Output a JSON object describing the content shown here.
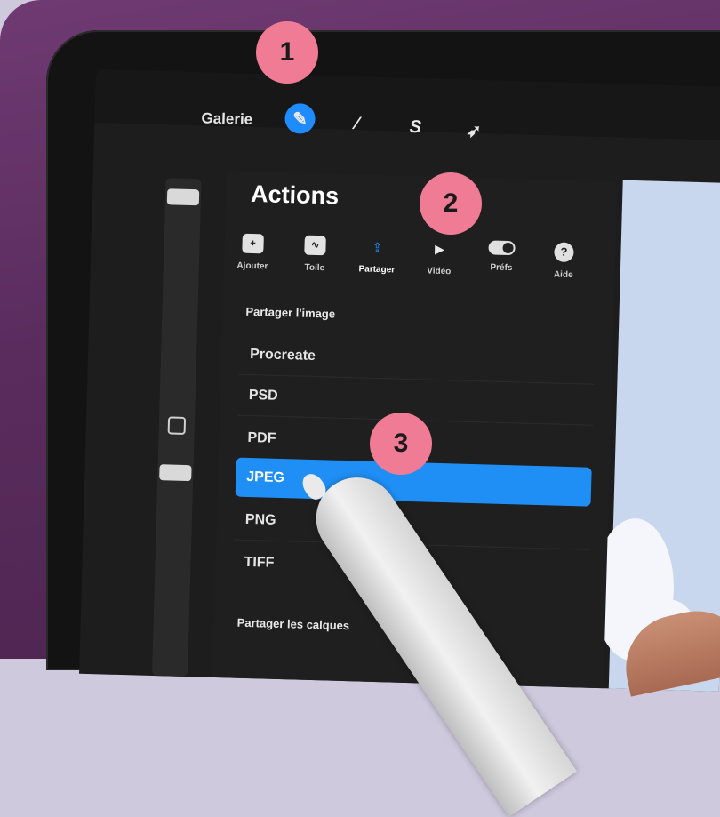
{
  "toolbar": {
    "gallery_label": "Galerie",
    "tools": [
      {
        "icon": "wrench-icon",
        "glyph": "✎",
        "active": true
      },
      {
        "icon": "magic-wand-icon",
        "glyph": "⁄"
      },
      {
        "icon": "selection-icon",
        "glyph": "S"
      },
      {
        "icon": "move-arrow-icon",
        "glyph": "➶"
      }
    ]
  },
  "actions_panel": {
    "title": "Actions",
    "tabs": [
      {
        "label": "Ajouter",
        "icon": "add-icon",
        "glyph": "+"
      },
      {
        "label": "Toile",
        "icon": "canvas-icon",
        "glyph": "∿"
      },
      {
        "label": "Partager",
        "icon": "share-icon",
        "glyph": "⇪",
        "active": true
      },
      {
        "label": "Vidéo",
        "icon": "video-play-icon",
        "glyph": "▶"
      },
      {
        "label": "Préfs",
        "icon": "toggle-icon",
        "glyph": ""
      },
      {
        "label": "Aide",
        "icon": "help-icon",
        "glyph": "?"
      }
    ],
    "share_image_heading": "Partager l'image",
    "formats": [
      "Procreate",
      "PSD",
      "PDF",
      "JPEG",
      "PNG",
      "TIFF"
    ],
    "selected_format": "JPEG",
    "share_layers_heading": "Partager les calques"
  },
  "badges": [
    "1",
    "2",
    "3"
  ],
  "colors": {
    "accent": "#1f8ff5",
    "badge": "#f07b95",
    "case": "#5a2c5e"
  }
}
